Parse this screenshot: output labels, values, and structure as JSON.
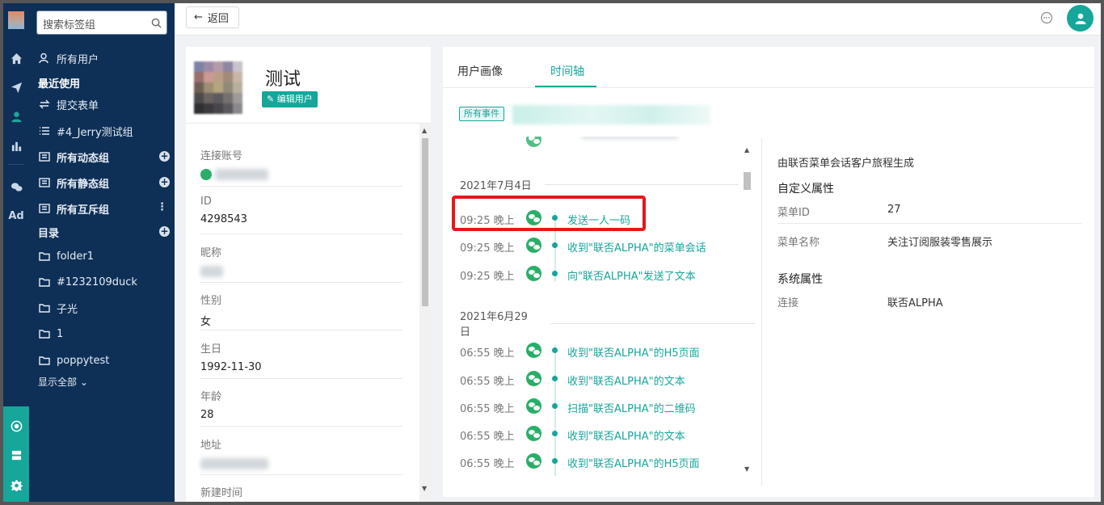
{
  "colors": {
    "accent": "#16a69a",
    "sidebar": "#0e2f56",
    "highlight": "#e8161b",
    "wechat": "#2aae67"
  },
  "rail": {
    "icons": [
      "home-icon",
      "send-icon",
      "user-icon",
      "chart-icon",
      "wechat-icon",
      "ad-icon",
      "gear-network-icon",
      "server-icon",
      "settings-icon"
    ],
    "ad_label": "Ad"
  },
  "sidebar": {
    "search_placeholder": "搜索标签组",
    "all_users": "所有用户",
    "recent": "最近使用",
    "submit_form": "提交表单",
    "recent_group": "#4_Jerry测试组",
    "dynamic_groups": "所有动态组",
    "static_groups": "所有静态组",
    "exclusive_groups": "所有互斥组",
    "catalog": "目录",
    "folders": [
      "folder1",
      "#1232109duck",
      "子光",
      "1",
      "poppytest"
    ],
    "show_all": "显示全部"
  },
  "topbar": {
    "back_label": "返回"
  },
  "profile": {
    "name_partial": "测试",
    "edit_label": "编辑用户",
    "fields": [
      {
        "label": "连接账号",
        "value": ""
      },
      {
        "label": "ID",
        "value": "4298543"
      },
      {
        "label": "昵称",
        "value": ""
      },
      {
        "label": "性别",
        "value": "女"
      },
      {
        "label": "生日",
        "value": "1992-11-30"
      },
      {
        "label": "年龄",
        "value": "28"
      },
      {
        "label": "地址",
        "value": ""
      },
      {
        "label": "新建时间",
        "value": ""
      }
    ]
  },
  "main": {
    "tabs": [
      {
        "label": "用户画像",
        "active": false
      },
      {
        "label": "时间轴",
        "active": true
      }
    ],
    "all_events_tag": "所有事件",
    "timeline": [
      {
        "date": "2021年7月4日",
        "events": [
          {
            "time": "09:25 晚上",
            "text": "发送一人一码",
            "highlighted": true
          },
          {
            "time": "09:25 晚上",
            "text": "收到\"联否ALPHA\"的菜单会话"
          },
          {
            "time": "09:25 晚上",
            "text": "向\"联否ALPHA\"发送了文本"
          }
        ]
      },
      {
        "date": "2021年6月29日",
        "events": [
          {
            "time": "06:55 晚上",
            "text": "收到\"联否ALPHA\"的H5页面"
          },
          {
            "time": "06:55 晚上",
            "text": "收到\"联否ALPHA\"的文本"
          },
          {
            "time": "06:55 晚上",
            "text": "扫描\"联否ALPHA\"的二维码"
          },
          {
            "time": "06:55 晚上",
            "text": "收到\"联否ALPHA\"的文本"
          },
          {
            "time": "06:55 晚上",
            "text": "收到\"联否ALPHA\"的H5页面"
          }
        ]
      }
    ]
  },
  "detail": {
    "subtitle": "由联否菜单会话客户旅程生成",
    "custom_title": "自定义属性",
    "custom": [
      {
        "key": "菜单ID",
        "value": "27"
      },
      {
        "key": "菜单名称",
        "value": "关注订阅服装零售展示"
      }
    ],
    "system_title": "系统属性",
    "system": [
      {
        "key": "连接",
        "value": "联否ALPHA"
      }
    ]
  }
}
